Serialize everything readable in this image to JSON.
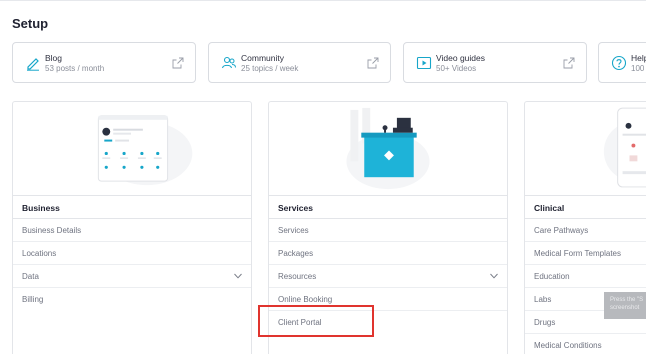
{
  "page": {
    "title": "Setup"
  },
  "resources": [
    {
      "title": "Blog",
      "subtitle": "53 posts / month",
      "icon": "pencil-icon"
    },
    {
      "title": "Community",
      "subtitle": "25 topics / week",
      "icon": "community-icon"
    },
    {
      "title": "Video guides",
      "subtitle": "50+ Videos",
      "icon": "play-icon"
    },
    {
      "title": "Help",
      "subtitle": "100",
      "icon": "help-icon"
    }
  ],
  "panels": {
    "business": {
      "title": "Business",
      "items": [
        "Business Details",
        "Locations",
        "Data",
        "Billing"
      ]
    },
    "services": {
      "title": "Services",
      "items": [
        "Services",
        "Packages",
        "Resources",
        "Online Booking",
        "Client Portal"
      ]
    },
    "clinical": {
      "title": "Clinical",
      "items": [
        "Care Pathways",
        "Medical Form Templates",
        "Education",
        "Labs",
        "Drugs",
        "Medical Conditions"
      ]
    }
  },
  "tooltip": {
    "line1": "Press the \"S",
    "line2": "screenshot"
  },
  "colors": {
    "accent": "#17a6c9",
    "highlight": "#e0342e",
    "icon": "#8a8e99"
  }
}
